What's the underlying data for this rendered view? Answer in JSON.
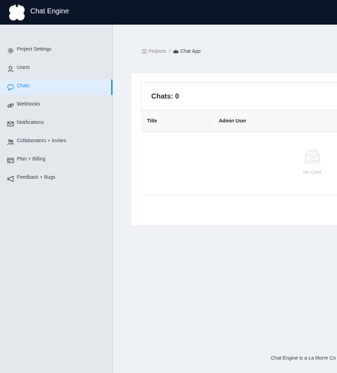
{
  "app": {
    "title": "Chat Engine"
  },
  "sidebar": {
    "items": [
      {
        "label": "Project Settings",
        "icon": "gear-icon",
        "active": false
      },
      {
        "label": "Users",
        "icon": "user-icon",
        "active": false
      },
      {
        "label": "Chats",
        "icon": "chat-icon",
        "active": true
      },
      {
        "label": "Webhooks",
        "icon": "link-icon",
        "active": false
      },
      {
        "label": "Notifications",
        "icon": "mail-icon",
        "active": false
      },
      {
        "label": "Collaborators + Invites",
        "icon": "team-icon",
        "active": false
      },
      {
        "label": "Plan + Billing",
        "icon": "card-icon",
        "active": false
      },
      {
        "label": "Feedback + Bugs",
        "icon": "megaphone-icon",
        "active": false
      }
    ]
  },
  "breadcrumb": {
    "projects": "Projects",
    "separator": "/",
    "current": "Chat App"
  },
  "chats": {
    "title": "Chats: 0",
    "columns": [
      "Title",
      "Admin User"
    ],
    "empty_text": "No Data"
  },
  "footer": {
    "text": "Chat Engine is a La Morre Co"
  },
  "colors": {
    "topbar": "#0a1628",
    "accent": "#1890ff",
    "sidebar": "#e4e8ed",
    "background": "#eef1f5"
  }
}
